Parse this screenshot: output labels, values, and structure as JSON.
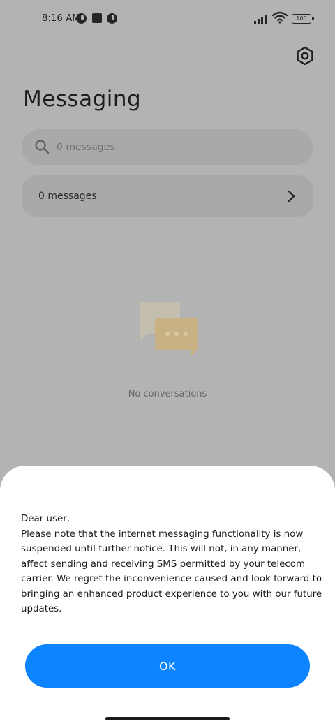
{
  "status_bar": {
    "time": "8:16 AM",
    "battery": "100"
  },
  "header": {
    "title": "Messaging",
    "settings_icon": "gear-icon"
  },
  "search": {
    "placeholder": "0 messages",
    "value": ""
  },
  "messages_row": {
    "label": "0 messages"
  },
  "empty_state": {
    "text": "No conversations"
  },
  "dialog": {
    "greeting": "Dear user,",
    "body": "Please note that the internet messaging functionality is now suspended until further notice. This will not, in any manner, affect sending and receiving SMS permitted by your telecom carrier. We regret the inconvenience caused and look forward to bringing an enhanced product experience to you with our future updates.",
    "ok_label": "OK"
  },
  "colors": {
    "accent": "#0d84ff",
    "overlay": "#b3b3b3",
    "empty_art_back": "#c7bfad",
    "empty_art_front": "#c9b07e"
  }
}
